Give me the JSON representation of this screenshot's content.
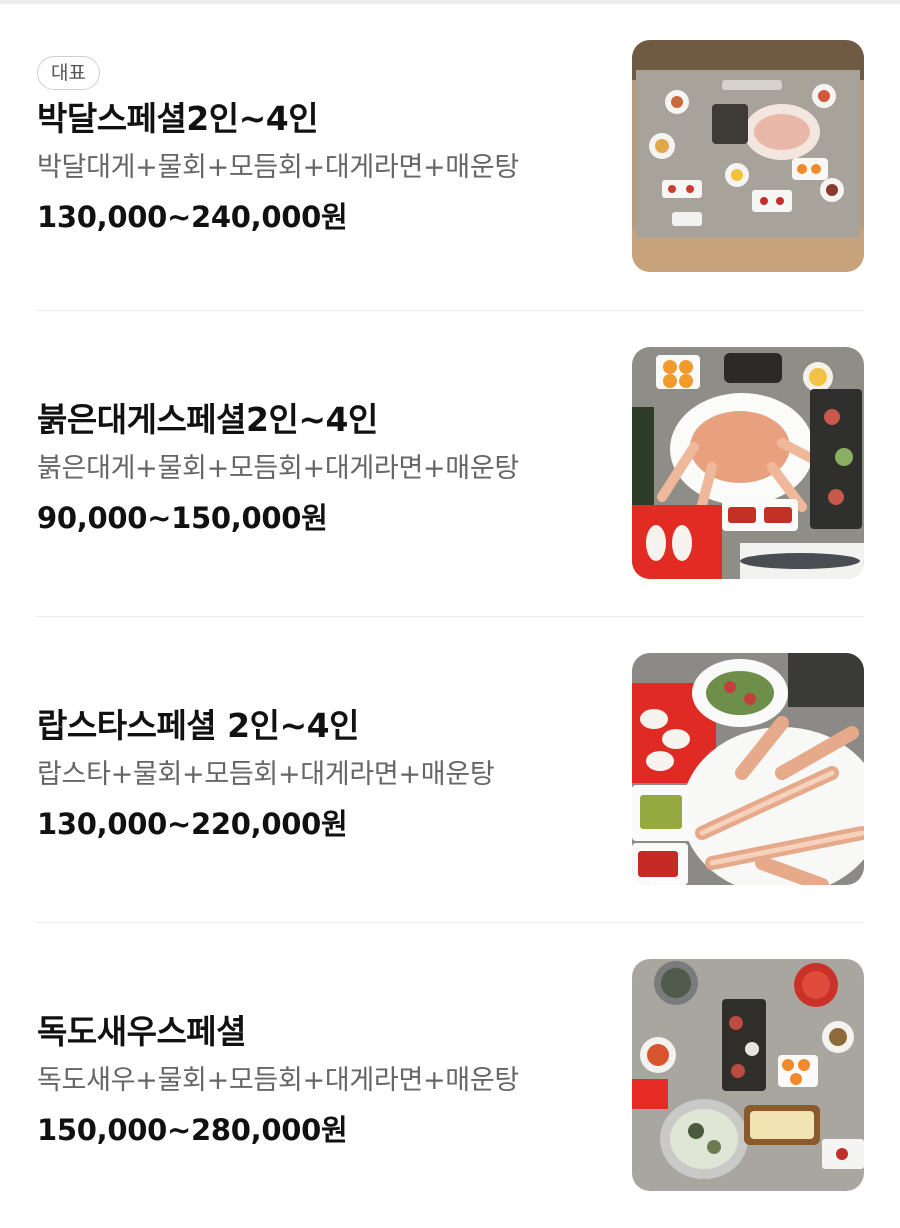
{
  "menu": {
    "items": [
      {
        "badge": "대표",
        "name": "박달스페셜2인~4인",
        "description": "박달대게+물회+모듬회+대게라면+매운탕",
        "price": "130,000~240,000원",
        "photo": "seafood-table-spread"
      },
      {
        "name": "붉은대게스페셜2인~4인",
        "description": "붉은대게+물회+모듬회+대게라면+매운탕",
        "price": "90,000~150,000원",
        "photo": "red-snow-crab-platter"
      },
      {
        "name": "랍스타스페셜 2인~4인",
        "description": "랍스타+물회+모듬회+대게라면+매운탕",
        "price": "130,000~220,000원",
        "photo": "crab-legs-platter"
      },
      {
        "name": "독도새우스페셜",
        "description": "독도새우+물회+모듬회+대게라면+매운탕",
        "price": "150,000~280,000원",
        "photo": "dokdo-shrimp-table-spread"
      }
    ]
  }
}
